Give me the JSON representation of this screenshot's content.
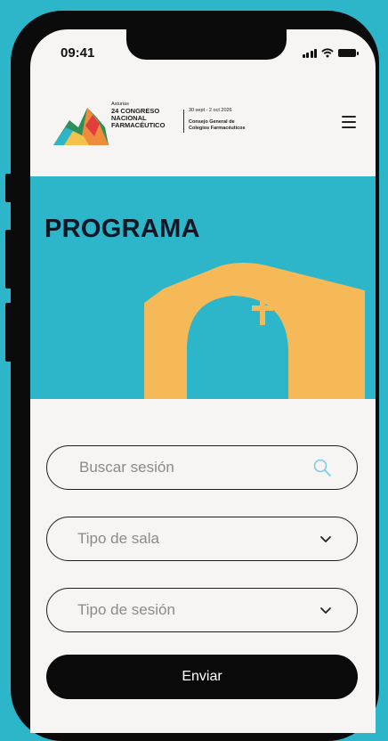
{
  "status_bar": {
    "time": "09:41"
  },
  "header": {
    "logo_small": "Asturias",
    "logo_line1": "24 CONGRESO",
    "logo_line2": "NACIONAL",
    "logo_line3": "FARMACÉUTICO",
    "dates": "30 sept - 2 oct 2026",
    "org_line1": "Consejo General de",
    "org_line2": "Colegios Farmacéuticos",
    "menu_icon": "hamburger-menu-icon"
  },
  "hero": {
    "title": "PROGRAMA"
  },
  "form": {
    "search_placeholder": "Buscar sesión",
    "search_icon": "search-icon",
    "room_type_label": "Tipo de sala",
    "session_type_label": "Tipo de sesión",
    "dropdown_icon": "chevron-down-icon",
    "submit_label": "Enviar"
  },
  "colors": {
    "background": "#2db5c9",
    "hero": "#2db5c9",
    "church": "#f6b957",
    "screen": "#f6f5f3",
    "button": "#0a0a0a",
    "search_icon": "#7fc9e2"
  }
}
